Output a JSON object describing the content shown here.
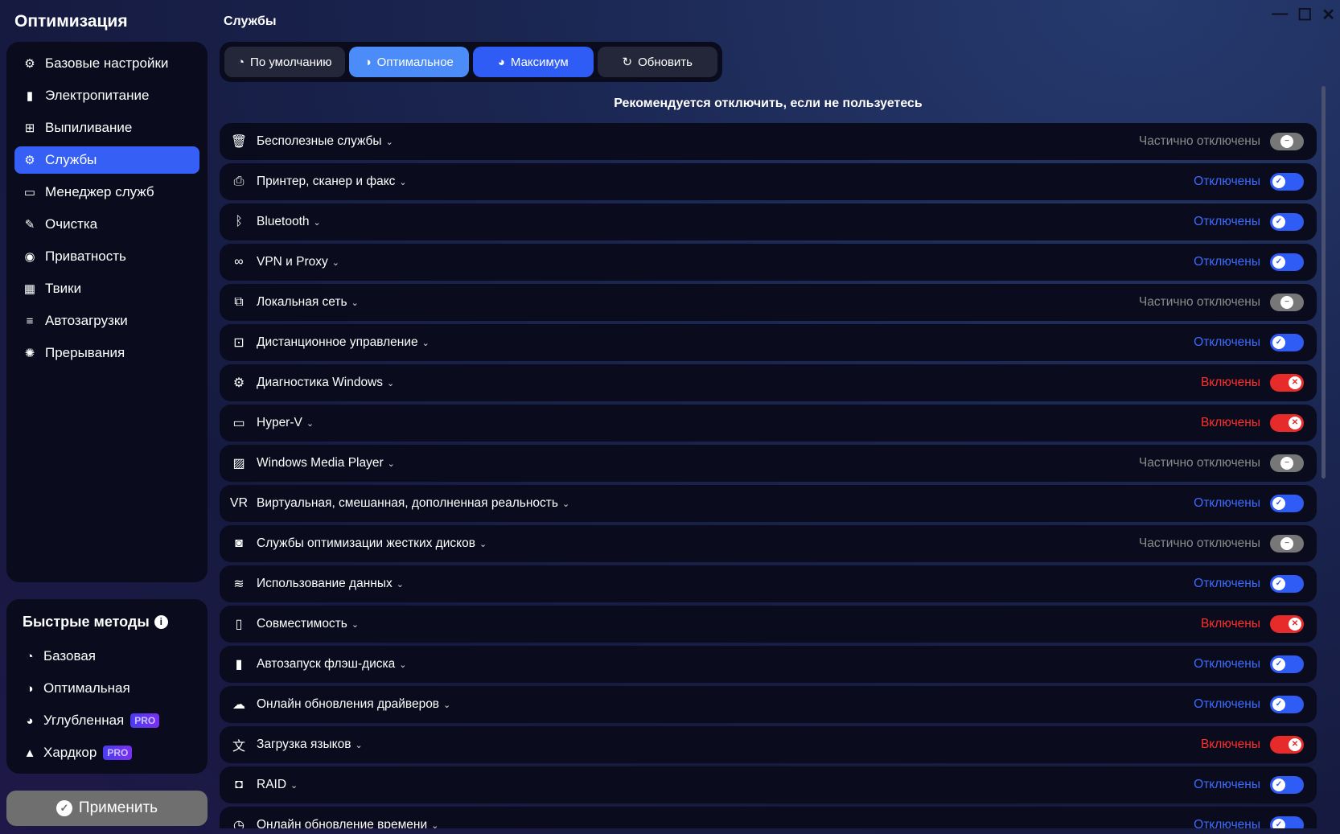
{
  "app_title": "Оптимизация",
  "page_title": "Службы",
  "nav": [
    {
      "label": "Базовые настройки",
      "icon": "wrench-gear-icon",
      "glyph": "⚙"
    },
    {
      "label": "Электропитание",
      "icon": "battery-icon",
      "glyph": "▮"
    },
    {
      "label": "Выпиливание",
      "icon": "windows-icon",
      "glyph": "⊞"
    },
    {
      "label": "Службы",
      "icon": "gears-icon",
      "glyph": "⚙",
      "active": true
    },
    {
      "label": "Менеджер служб",
      "icon": "window-gear-icon",
      "glyph": "▭"
    },
    {
      "label": "Очистка",
      "icon": "broom-icon",
      "glyph": "✎"
    },
    {
      "label": "Приватность",
      "icon": "spy-icon",
      "glyph": "◉"
    },
    {
      "label": "Твики",
      "icon": "grid-icon",
      "glyph": "▦"
    },
    {
      "label": "Автозагрузки",
      "icon": "startup-icon",
      "glyph": "≡"
    },
    {
      "label": "Прерывания",
      "icon": "interrupt-gear-icon",
      "glyph": "✺"
    }
  ],
  "quick": {
    "title": "Быстрые методы",
    "info_icon": "i",
    "items": [
      {
        "label": "Базовая",
        "icon": "gauge-low-icon",
        "glyph": "◔"
      },
      {
        "label": "Оптимальная",
        "icon": "gauge-mid-icon",
        "glyph": "◑"
      },
      {
        "label": "Углубленная",
        "icon": "gauge-high-icon",
        "glyph": "◕",
        "badge": "PRO"
      },
      {
        "label": "Хардкор",
        "icon": "warning-icon",
        "glyph": "▲",
        "badge": "PRO"
      }
    ]
  },
  "apply_label": "Применить",
  "tabs": [
    {
      "label": "По умолчанию",
      "glyph": "◔"
    },
    {
      "label": "Оптимальное",
      "glyph": "◑"
    },
    {
      "label": "Максимум",
      "glyph": "◕"
    },
    {
      "label": "Обновить",
      "glyph": "↻"
    }
  ],
  "heading": "Рекомендуется отключить, если не пользуетесь",
  "colors": {
    "accent": "#2f5cf4",
    "partial": "#777777",
    "enabled": "#e72a2a"
  },
  "services": [
    {
      "name": "Бесполезные службы",
      "icon": "trash-icon",
      "glyph": "🗑",
      "status": "Частично отключены",
      "state": "partial"
    },
    {
      "name": "Принтер, сканер и факс",
      "icon": "printer-icon",
      "glyph": "⎙",
      "status": "Отключены",
      "state": "off"
    },
    {
      "name": "Bluetooth",
      "icon": "bluetooth-icon",
      "glyph": "ᛒ",
      "status": "Отключены",
      "state": "off"
    },
    {
      "name": "VPN и Proxy",
      "icon": "vpn-icon",
      "glyph": "∞",
      "status": "Отключены",
      "state": "off"
    },
    {
      "name": "Локальная сеть",
      "icon": "network-icon",
      "glyph": "⧉",
      "status": "Частично отключены",
      "state": "partial"
    },
    {
      "name": "Дистанционное управление",
      "icon": "remote-icon",
      "glyph": "⊡",
      "status": "Отключены",
      "state": "off"
    },
    {
      "name": "Диагностика Windows",
      "icon": "gear-icon",
      "glyph": "⚙",
      "status": "Включены",
      "state": "on"
    },
    {
      "name": "Hyper-V",
      "icon": "laptop-icon",
      "glyph": "▭",
      "status": "Включены",
      "state": "on"
    },
    {
      "name": "Windows Media Player",
      "icon": "images-icon",
      "glyph": "▨",
      "status": "Частично отключены",
      "state": "partial"
    },
    {
      "name": "Виртуальная, смешанная, дополненная реальность",
      "icon": "vr-icon",
      "glyph": "VR",
      "status": "Отключены",
      "state": "off"
    },
    {
      "name": "Службы оптимизации жестких дисков",
      "icon": "hard-disk-icon",
      "glyph": "◙",
      "status": "Частично отключены",
      "state": "partial"
    },
    {
      "name": "Использование данных",
      "icon": "wifi-icon",
      "glyph": "≋",
      "status": "Отключены",
      "state": "off"
    },
    {
      "name": "Совместимость",
      "icon": "compat-icon",
      "glyph": "▯",
      "status": "Включены",
      "state": "on"
    },
    {
      "name": "Автозапуск флэш-диска",
      "icon": "usb-icon",
      "glyph": "▮",
      "status": "Отключены",
      "state": "off"
    },
    {
      "name": "Онлайн обновления драйверов",
      "icon": "cloud-download-icon",
      "glyph": "☁",
      "status": "Отключены",
      "state": "off"
    },
    {
      "name": "Загрузка языков",
      "icon": "translate-icon",
      "glyph": "文",
      "status": "Включены",
      "state": "on"
    },
    {
      "name": "RAID",
      "icon": "raid-icon",
      "glyph": "◘",
      "status": "Отключены",
      "state": "off"
    },
    {
      "name": "Онлайн обновление времени",
      "icon": "clock-sync-icon",
      "glyph": "◷",
      "status": "Отключены",
      "state": "off"
    }
  ]
}
